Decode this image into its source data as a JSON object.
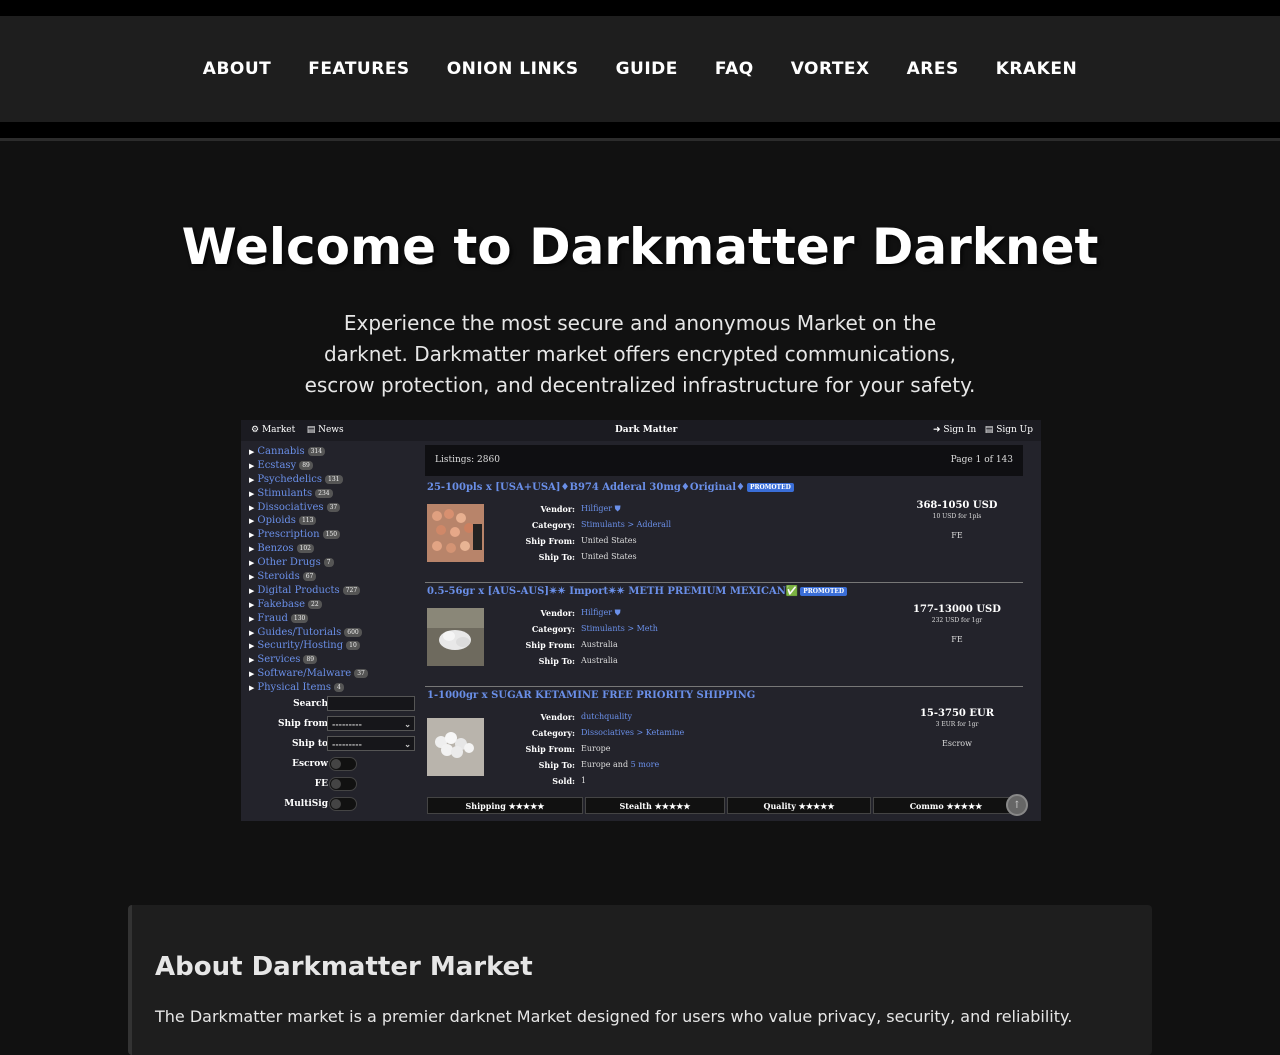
{
  "nav": {
    "items": [
      "ABOUT",
      "FEATURES",
      "ONION LINKS",
      "GUIDE",
      "FAQ",
      "VORTEX",
      "ARES",
      "KRAKEN"
    ]
  },
  "hero": {
    "title": "Welcome to Darkmatter Darknet",
    "description": "Experience the most secure and anonymous Market on the darknet. Darkmatter market offers encrypted communications, escrow protection, and decentralized infrastructure for your safety."
  },
  "screenshot": {
    "header": {
      "market": "Market",
      "news": "News",
      "site_title": "Dark Matter",
      "sign_in": "Sign In",
      "sign_up": "Sign Up"
    },
    "categories": [
      {
        "name": "Cannabis",
        "count": "314"
      },
      {
        "name": "Ecstasy",
        "count": "89"
      },
      {
        "name": "Psychedelics",
        "count": "131"
      },
      {
        "name": "Stimulants",
        "count": "234"
      },
      {
        "name": "Dissociatives",
        "count": "37"
      },
      {
        "name": "Opioids",
        "count": "113"
      },
      {
        "name": "Prescription",
        "count": "150"
      },
      {
        "name": "Benzos",
        "count": "102"
      },
      {
        "name": "Other Drugs",
        "count": "7"
      },
      {
        "name": "Steroids",
        "count": "67"
      },
      {
        "name": "Digital Products",
        "count": "727"
      },
      {
        "name": "Fakebase",
        "count": "22"
      },
      {
        "name": "Fraud",
        "count": "130"
      },
      {
        "name": "Guides/Tutorials",
        "count": "600"
      },
      {
        "name": "Security/Hosting",
        "count": "10"
      },
      {
        "name": "Services",
        "count": "89"
      },
      {
        "name": "Software/Malware",
        "count": "37"
      },
      {
        "name": "Physical Items",
        "count": "4"
      }
    ],
    "filters": {
      "search_label": "Search",
      "ship_from_label": "Ship from",
      "ship_from_value": "---------",
      "ship_to_label": "Ship to",
      "ship_to_value": "---------",
      "escrow_label": "Escrow",
      "fe_label": "FE",
      "multisig_label": "MultiSig"
    },
    "listings_label": "Listings: 2860",
    "page_label": "Page 1 of 143",
    "labels": {
      "vendor": "Vendor:",
      "category": "Category:",
      "ship_from": "Ship From:",
      "ship_to": "Ship To:",
      "sold": "Sold:"
    },
    "items": [
      {
        "title": "25-100pls x [USA+USA]♦B974 Adderal 30mg♦Original♦",
        "promoted": "PROMOTED",
        "vendor": "Hilfiger ⛊",
        "category": "Stimulants > Adderall",
        "ship_from": "United States",
        "ship_to": "United States",
        "price": "368-1050 USD",
        "unit": "10 USD for 1pls",
        "method": "FE"
      },
      {
        "title": "0.5-56gr x [AUS-AUS]✴✴ Import✴✴ METH PREMIUM MEXICAN✅",
        "promoted": "PROMOTED",
        "vendor": "Hilfiger ⛊",
        "category": "Stimulants > Meth",
        "ship_from": "Australia",
        "ship_to": "Australia",
        "price": "177-13000 USD",
        "unit": "232 USD for 1gr",
        "method": "FE"
      },
      {
        "title": "1-1000gr x SUGAR KETAMINE FREE PRIORITY SHIPPING",
        "vendor": "dutchquality",
        "category": "Dissociatives > Ketamine",
        "ship_from": "Europe",
        "ship_to": "Europe and",
        "ship_to_more": "5 more",
        "sold": "1",
        "price": "15-3750 EUR",
        "unit": "3 EUR for 1gr",
        "method": "Escrow"
      }
    ],
    "ratings": [
      {
        "label": "Shipping ★★★★★"
      },
      {
        "label": "Stealth ★★★★★"
      },
      {
        "label": "Quality ★★★★★"
      },
      {
        "label": "Commo ★★★★★"
      }
    ]
  },
  "about": {
    "heading": "About Darkmatter Market",
    "text": "The Darkmatter market is a premier darknet Market designed for users who value privacy, security, and reliability."
  },
  "colors": {
    "background": "#111111",
    "nav": "#1e1e1e",
    "link": "#6a8fe8",
    "promoted": "#3a6ed8"
  }
}
